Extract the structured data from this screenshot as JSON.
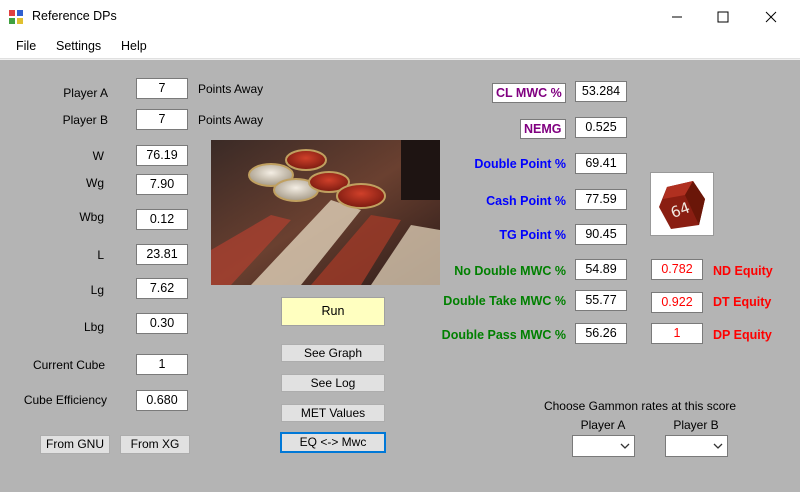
{
  "window": {
    "title": "Reference DPs"
  },
  "menu": {
    "file": "File",
    "settings": "Settings",
    "help": "Help"
  },
  "left": {
    "player_a_label": "Player A",
    "player_a_value": "7",
    "player_a_suffix": "Points Away",
    "player_b_label": "Player B",
    "player_b_value": "7",
    "player_b_suffix": "Points Away",
    "w_label": "W",
    "w_value": "76.19",
    "wg_label": "Wg",
    "wg_value": "7.90",
    "wbg_label": "Wbg",
    "wbg_value": "0.12",
    "l_label": "L",
    "l_value": "23.81",
    "lg_label": "Lg",
    "lg_value": "7.62",
    "lbg_label": "Lbg",
    "lbg_value": "0.30",
    "cube_label": "Current Cube",
    "cube_value": "1",
    "eff_label": "Cube Efficiency",
    "eff_value": "0.680",
    "from_gnu": "From GNU",
    "from_xg": "From XG"
  },
  "center": {
    "run": "Run",
    "see_graph": "See Graph",
    "see_log": "See Log",
    "met_values": "MET Values",
    "eq_mwc": "EQ <-> Mwc"
  },
  "right": {
    "cl_mwc_label": "CL MWC %",
    "cl_mwc_value": "53.284",
    "nemg_label": "NEMG",
    "nemg_value": "0.525",
    "dp_label": "Double Point %",
    "dp_value": "69.41",
    "cp_label": "Cash Point %",
    "cp_value": "77.59",
    "tg_label": "TG Point %",
    "tg_value": "90.45",
    "nd_mwc_label": "No Double MWC %",
    "nd_mwc_value": "54.89",
    "dt_mwc_label": "Double Take MWC %",
    "dt_mwc_value": "55.77",
    "dpass_mwc_label": "Double Pass MWC %",
    "dpass_mwc_value": "56.26",
    "nd_eq_value": "0.782",
    "nd_eq_label": "ND Equity",
    "dt_eq_value": "0.922",
    "dt_eq_label": "DT Equity",
    "dp_eq_value": "1",
    "dp_eq_label": "DP Equity",
    "gammon_prompt": "Choose Gammon rates at this score",
    "gammon_player_a": "Player A",
    "gammon_player_b": "Player B"
  },
  "dice": {
    "cube_faces": "64"
  },
  "colors": {
    "purple": "#800080",
    "blue": "#0000ff",
    "green": "#008000",
    "red": "#ff0000",
    "run_bg": "#ffffc0",
    "client_bg": "#b4b4b4"
  }
}
